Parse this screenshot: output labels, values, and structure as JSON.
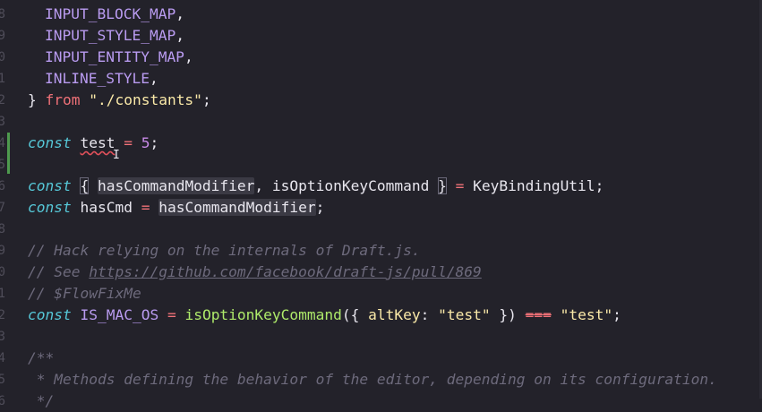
{
  "editor": {
    "line_numbers": [
      "8",
      "9",
      "0",
      "1",
      "2",
      "3",
      "4",
      "5",
      "6",
      "7",
      "8",
      "9",
      "0",
      "1",
      "2",
      "3",
      "4",
      "5",
      "6"
    ],
    "tokens": {
      "input_block_map": "INPUT_BLOCK_MAP",
      "input_style_map": "INPUT_STYLE_MAP",
      "input_entity_map": "INPUT_ENTITY_MAP",
      "inline_style": "INLINE_STYLE",
      "comma": ",",
      "close_brace": "}",
      "open_brace": "{",
      "from_kw": "from",
      "constants_path": "\"./constants\"",
      "semicolon": ";",
      "const_kw": "const",
      "test_var": "test",
      "equals": "=",
      "five": "5",
      "has_command_modifier": "hasCommandModifier",
      "is_option_key_command": "isOptionKeyCommand",
      "key_binding_util": "KeyBindingUtil",
      "has_cmd": "hasCmd",
      "comment_hack": "// Hack relying on the internals of Draft.js.",
      "comment_see": "// See ",
      "comment_url": "https://github.com/facebook/draft-js/pull/869",
      "comment_flow": "// $FlowFixMe",
      "is_mac_os": "IS_MAC_OS",
      "call_open": "({ ",
      "alt_key": "altKey",
      "colon": ":",
      "test_string": "\"test\"",
      "call_close": " })",
      "strict_eq": "===",
      "jsdoc_open": "/**",
      "jsdoc_methods": " * Methods defining the behavior of the editor, depending on its configuration.",
      "jsdoc_close": " */"
    },
    "colors": {
      "background": "#23222a",
      "keyword": "#56c8d8",
      "string": "#fae9a8",
      "function": "#aeea6a",
      "constant": "#b99bf0",
      "comment": "#6d6a7c",
      "git_modified": "#4e9a4e"
    },
    "cursor_icon": "text-cursor-icon"
  }
}
